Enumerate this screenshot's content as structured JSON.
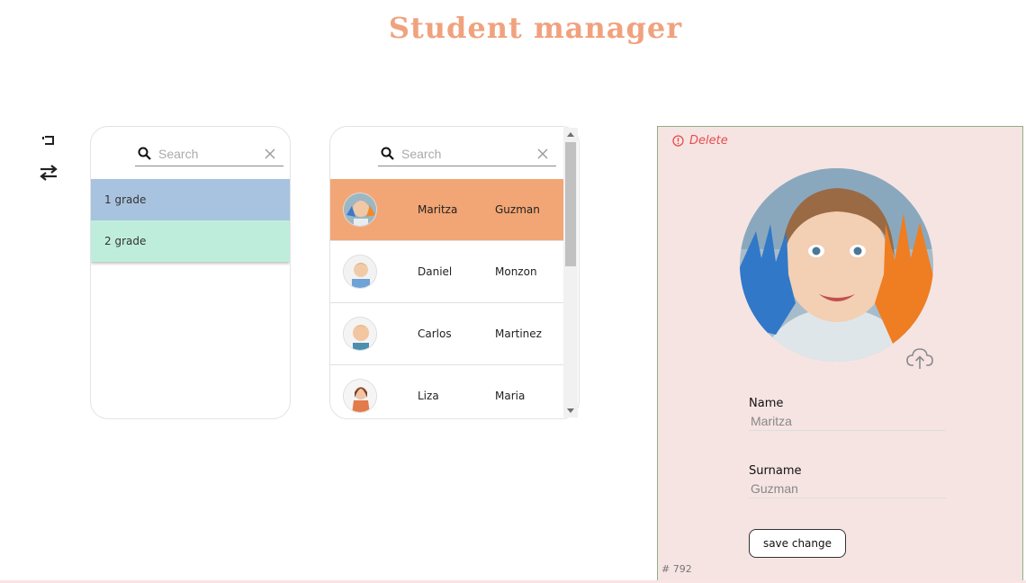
{
  "app": {
    "title": "Student manager"
  },
  "tools": [
    {
      "name": "undo-icon"
    },
    {
      "name": "swap-icon"
    }
  ],
  "grades_panel": {
    "search": {
      "placeholder": "Search",
      "value": ""
    },
    "items": [
      {
        "label": "1 grade",
        "color": "#a8c3df"
      },
      {
        "label": "2 grade",
        "color": "#bfeddc"
      }
    ]
  },
  "students_panel": {
    "search": {
      "placeholder": "Search",
      "value": ""
    },
    "rows": [
      {
        "first": "Maritza",
        "last": "Guzman",
        "selected": true
      },
      {
        "first": "Daniel",
        "last": "Monzon",
        "selected": false
      },
      {
        "first": "Carlos",
        "last": "Martinez",
        "selected": false
      },
      {
        "first": "Liza",
        "last": "Maria",
        "selected": false
      }
    ]
  },
  "detail": {
    "delete_label": "Delete",
    "name_label": "Name",
    "name_value": "Maritza",
    "surname_label": "Surname",
    "surname_value": "Guzman",
    "save_label": "save change",
    "record_id": "# 792"
  },
  "colors": {
    "accent": "#f0a27f",
    "selected_row": "#f2a675",
    "detail_bg": "#f6e4e3",
    "delete": "#e64d4d"
  }
}
